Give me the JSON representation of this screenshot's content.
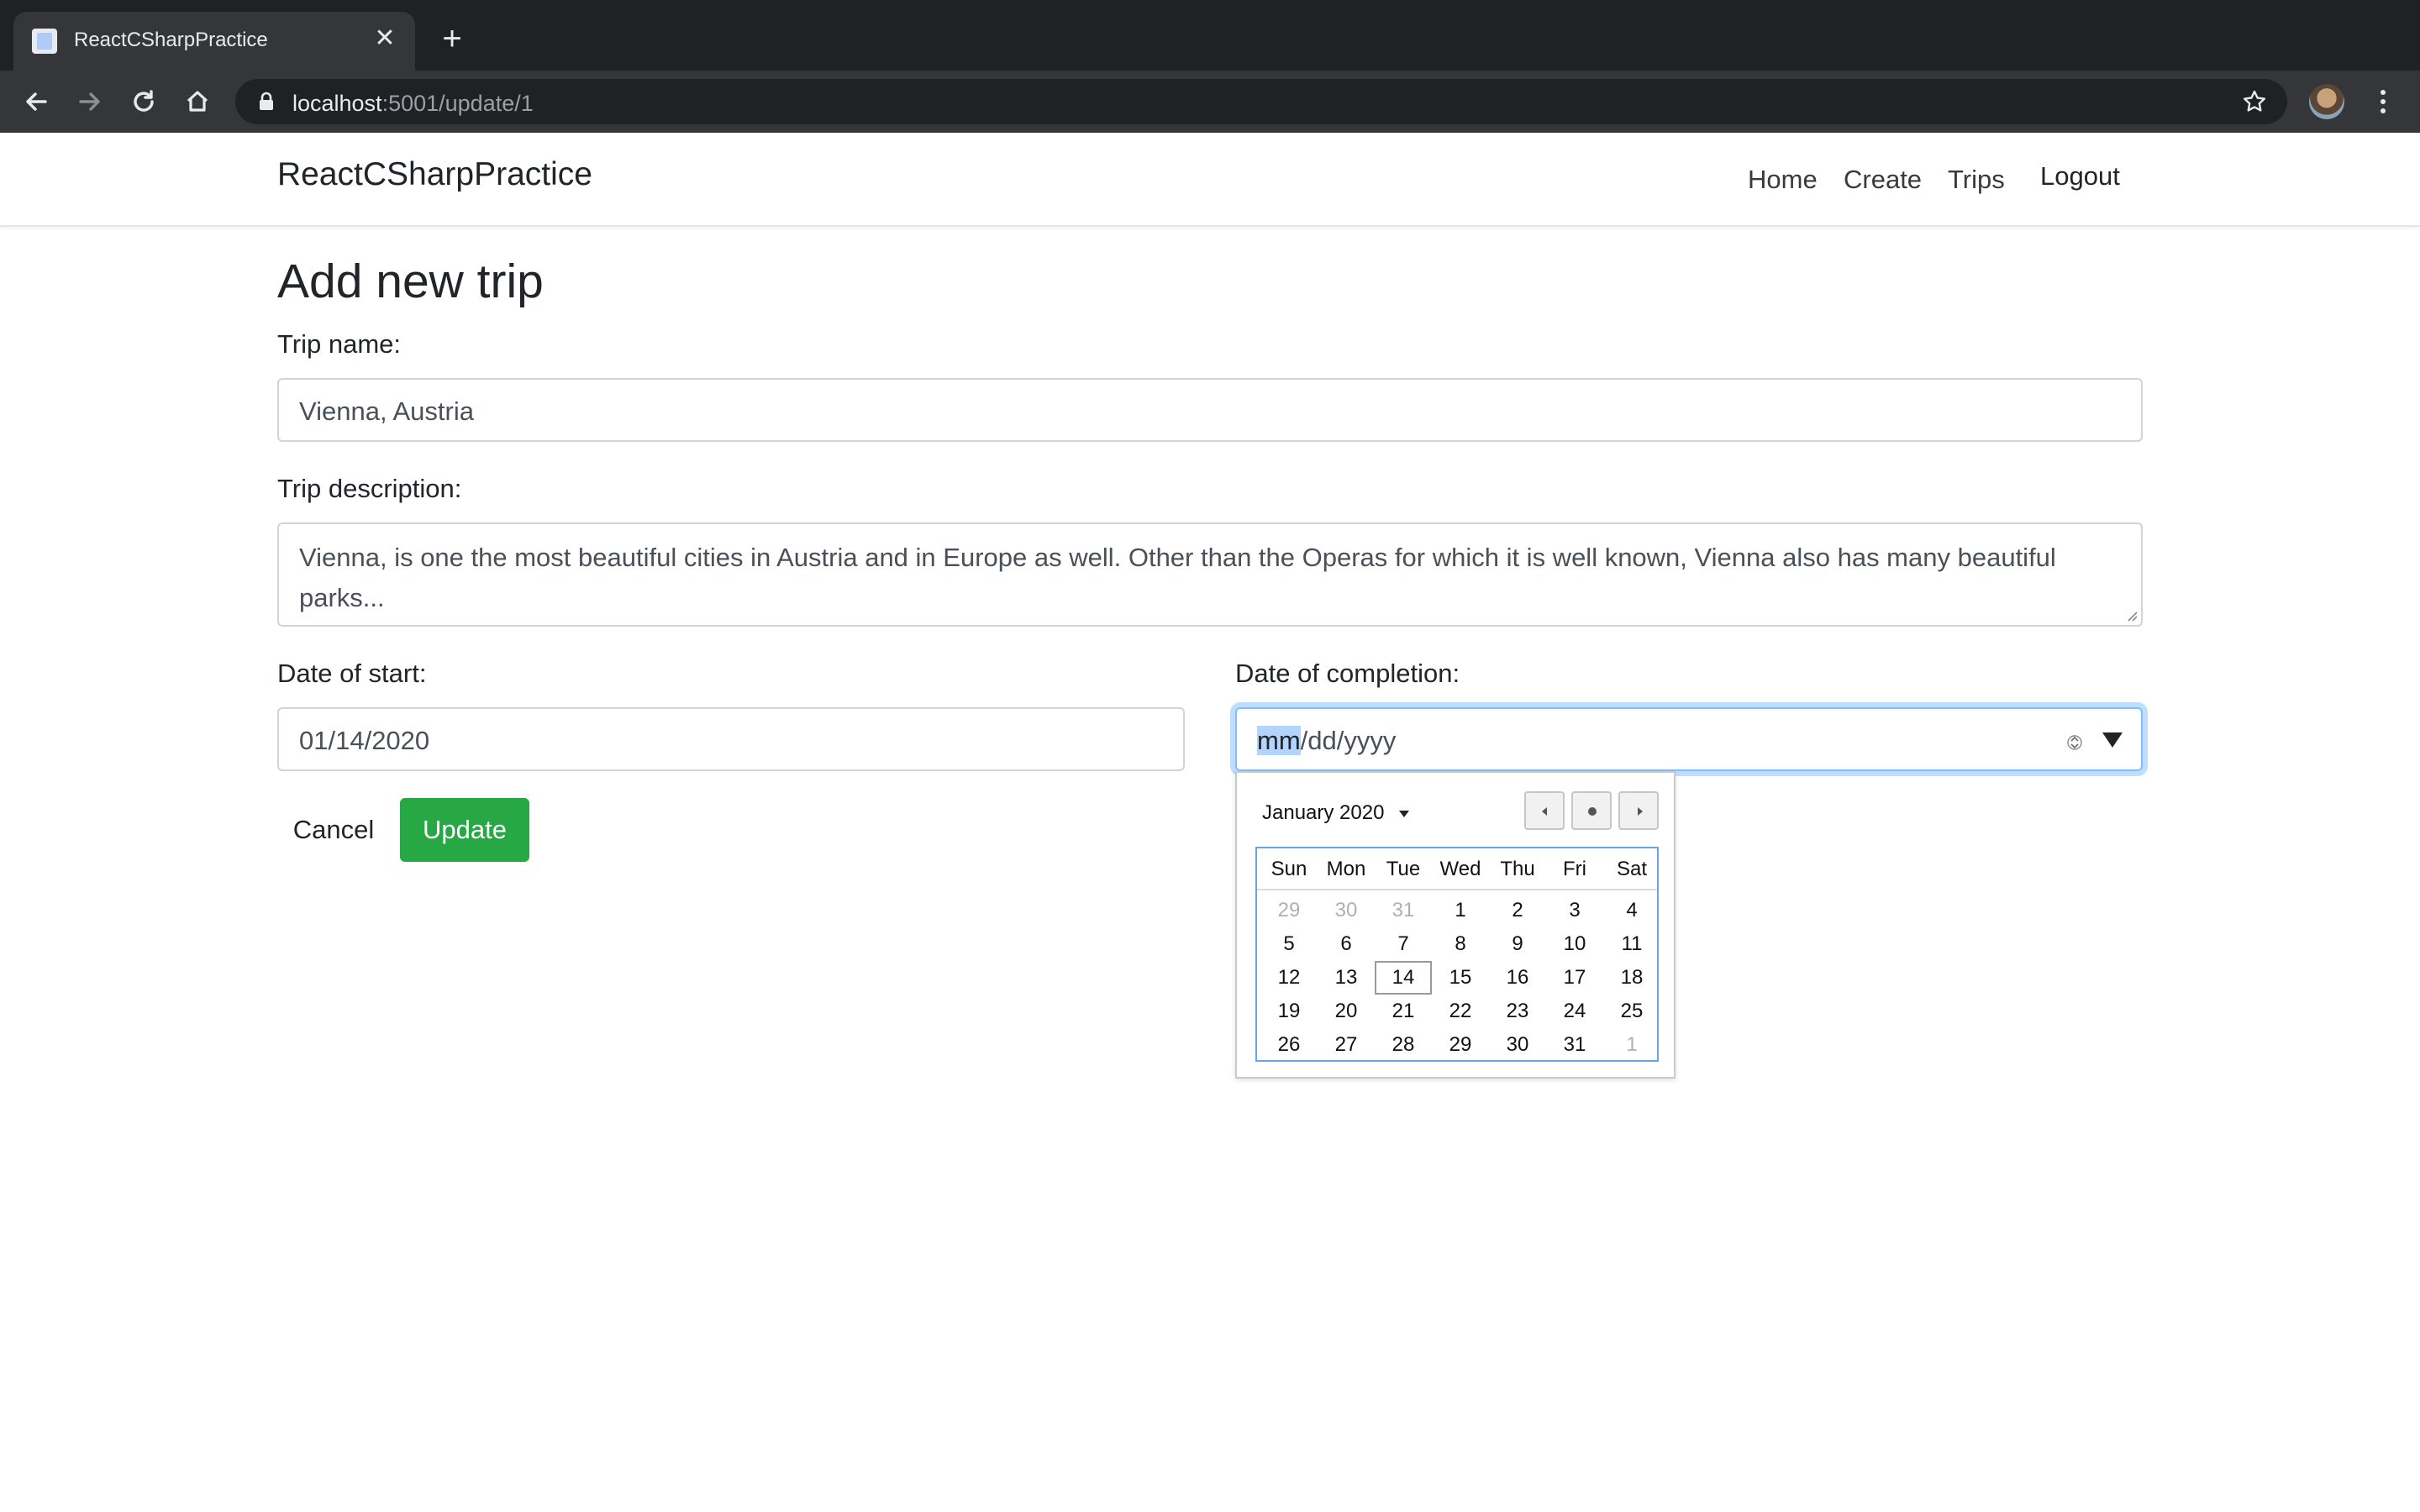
{
  "browser": {
    "tab_title": "ReactCSharpPractice",
    "tab_close": "✕",
    "new_tab": "+",
    "url_host": "localhost",
    "url_path": ":5001/update/1"
  },
  "navbar": {
    "brand": "ReactCSharpPractice",
    "links": [
      "Home",
      "Create",
      "Trips",
      "Logout"
    ]
  },
  "form": {
    "title": "Add new trip",
    "name_label": "Trip name:",
    "name_value": "Vienna, Austria",
    "description_label": "Trip description:",
    "description_value": "Vienna, is one the most beautiful cities in Austria and in Europe as well. Other than the Operas for which it is well known, Vienna also has many beautiful parks...",
    "start_label": "Date of start:",
    "start_value": "01/14/2020",
    "completion_label": "Date of completion:",
    "completion_mm": "mm",
    "completion_rest": "/dd/yyyy",
    "cancel_label": "Cancel",
    "update_label": "Update"
  },
  "datepicker": {
    "month_label": "January 2020",
    "weekdays": [
      "Sun",
      "Mon",
      "Tue",
      "Wed",
      "Thu",
      "Fri",
      "Sat"
    ],
    "weeks": [
      [
        "29",
        "30",
        "31",
        "1",
        "2",
        "3",
        "4"
      ],
      [
        "5",
        "6",
        "7",
        "8",
        "9",
        "10",
        "11"
      ],
      [
        "12",
        "13",
        "14",
        "15",
        "16",
        "17",
        "18"
      ],
      [
        "19",
        "20",
        "21",
        "22",
        "23",
        "24",
        "25"
      ],
      [
        "26",
        "27",
        "28",
        "29",
        "30",
        "31",
        "1"
      ]
    ],
    "selected_day": "14"
  },
  "colors": {
    "accent_focus": "#80bdff",
    "update_button": "#28a745",
    "calendar_border": "#6aa3e8"
  }
}
